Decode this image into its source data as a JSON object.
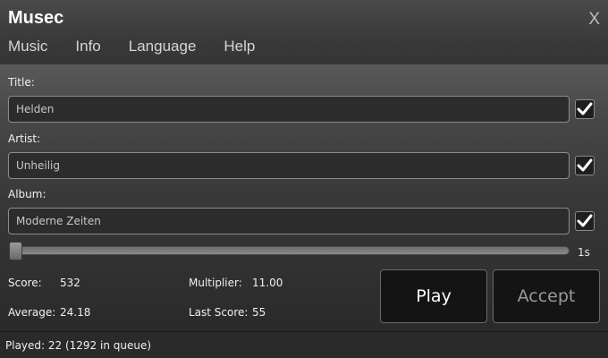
{
  "window": {
    "title": "Musec",
    "close_label": "X"
  },
  "menu": {
    "items": [
      "Music",
      "Info",
      "Language",
      "Help"
    ]
  },
  "form": {
    "title_label": "Title:",
    "title_value": "Helden",
    "artist_label": "Artist:",
    "artist_value": "Unheilig",
    "album_label": "Album:",
    "album_value": "Moderne Zeiten",
    "title_checked": true,
    "artist_checked": true,
    "album_checked": true
  },
  "slider": {
    "value_label": "1s",
    "position_fraction": 0.0
  },
  "stats": {
    "score_label": "Score:",
    "score_value": "532",
    "multiplier_label": "Multiplier:",
    "multiplier_value": "11.00",
    "average_label": "Average:",
    "average_value": "24.18",
    "last_score_label": "Last Score:",
    "last_score_value": "55"
  },
  "buttons": {
    "play_label": "Play",
    "accept_label": "Accept"
  },
  "status": {
    "text": "Played: 22 (1292 in queue)"
  },
  "icons": {
    "checkbox": "checkmark-icon",
    "close": "close-icon"
  }
}
